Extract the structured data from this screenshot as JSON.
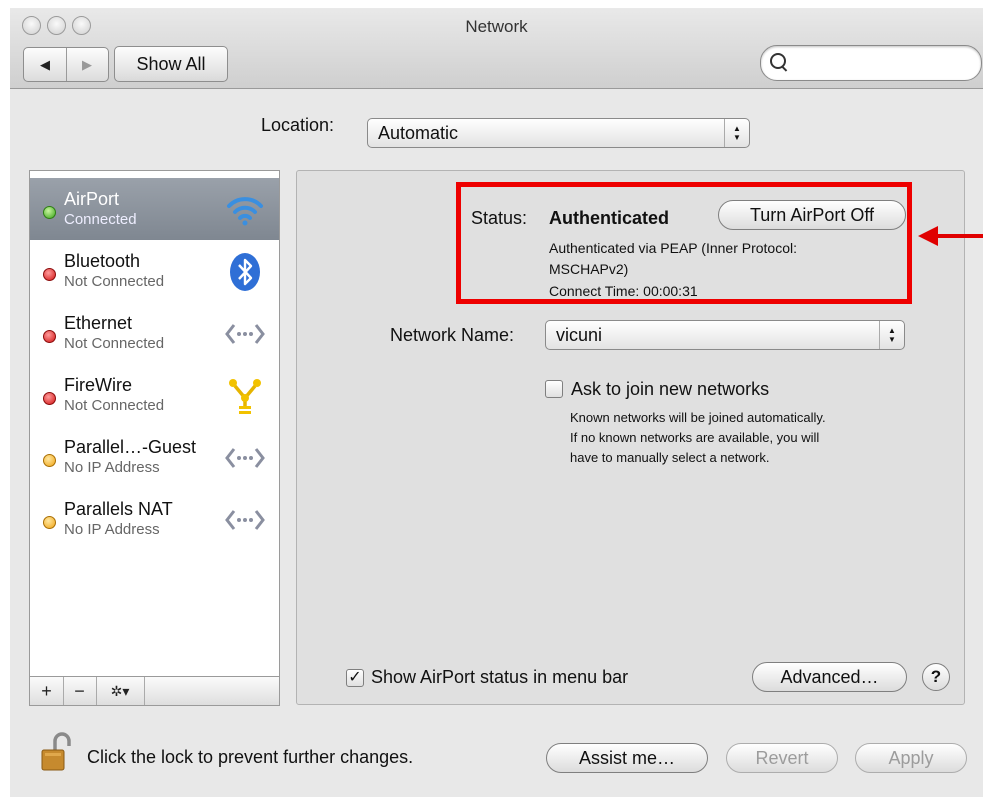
{
  "window": {
    "title": "Network"
  },
  "toolbar": {
    "back_glyph": "◀",
    "forward_glyph": "▶",
    "show_all_label": "Show All",
    "search_placeholder": ""
  },
  "location": {
    "label": "Location:",
    "value": "Automatic"
  },
  "sidebar": {
    "services": [
      {
        "name": "AirPort",
        "status": "Connected",
        "status_color": "green",
        "icon": "wifi-icon",
        "selected": true
      },
      {
        "name": "Bluetooth",
        "status": "Not Connected",
        "status_color": "red",
        "icon": "bluetooth-icon",
        "selected": false
      },
      {
        "name": "Ethernet",
        "status": "Not Connected",
        "status_color": "red",
        "icon": "ethernet-icon",
        "selected": false
      },
      {
        "name": "FireWire",
        "status": "Not Connected",
        "status_color": "red",
        "icon": "firewire-icon",
        "selected": false
      },
      {
        "name": "Parallel…-Guest",
        "status": "No IP Address",
        "status_color": "yellow",
        "icon": "ethernet-icon",
        "selected": false
      },
      {
        "name": "Parallels NAT",
        "status": "No IP Address",
        "status_color": "yellow",
        "icon": "ethernet-icon",
        "selected": false
      }
    ],
    "add_glyph": "+",
    "remove_glyph": "−",
    "action_glyph": "✲▾"
  },
  "detail": {
    "status_label": "Status:",
    "status_value": "Authenticated",
    "turn_off_button": "Turn AirPort Off",
    "status_detail_line1": "Authenticated via PEAP (Inner Protocol:",
    "status_detail_line2": "MSCHAPv2)",
    "connect_time": "Connect Time: 00:00:31",
    "network_name_label": "Network Name:",
    "network_name_value": "vicuni",
    "ask_join_label": "Ask to join new networks",
    "ask_join_checked": false,
    "ask_join_help_1": "Known networks will be joined automatically.",
    "ask_join_help_2": "If no known networks are available, you will",
    "ask_join_help_3": "have to manually select a network.",
    "show_status_label": "Show AirPort status in menu bar",
    "show_status_checked": true,
    "advanced_button": "Advanced…",
    "help_glyph": "?"
  },
  "footer": {
    "lock_text": "Click the lock to prevent further changes.",
    "assist_button": "Assist me…",
    "revert_button": "Revert",
    "apply_button": "Apply"
  },
  "annotation": {
    "highlight_color": "#ee0000"
  },
  "colors": {
    "selected_row": "#8a929c",
    "status_green": "#3aa51a",
    "status_red": "#d21313",
    "status_yellow": "#f0a414"
  }
}
